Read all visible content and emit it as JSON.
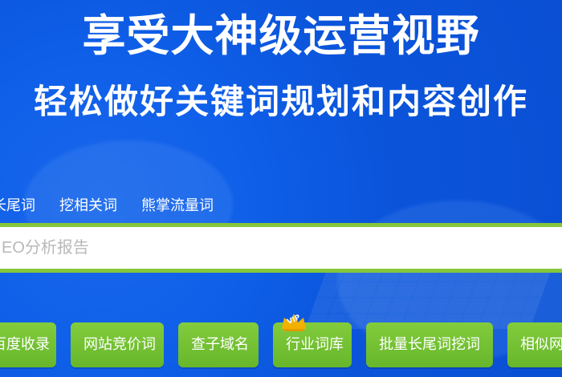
{
  "hero": {
    "title": "享受大神级运营视野",
    "subtitle": "轻松做好关键词规划和内容创作"
  },
  "search": {
    "tabs": [
      "长尾词",
      "挖相关词",
      "熊掌流量词"
    ],
    "placeholder": "EO分析报告"
  },
  "tools": {
    "buttons": [
      "百度收录",
      "网站竞价词",
      "查子域名",
      "行业词库",
      "批量长尾词挖词",
      "相似网站"
    ],
    "vip_badge": "VIP"
  },
  "icons": {
    "vip_badge": "crown-icon"
  },
  "colors": {
    "background": "#0b57dc",
    "accent_green": "#86c63b",
    "badge_gold": "#f2b100"
  }
}
